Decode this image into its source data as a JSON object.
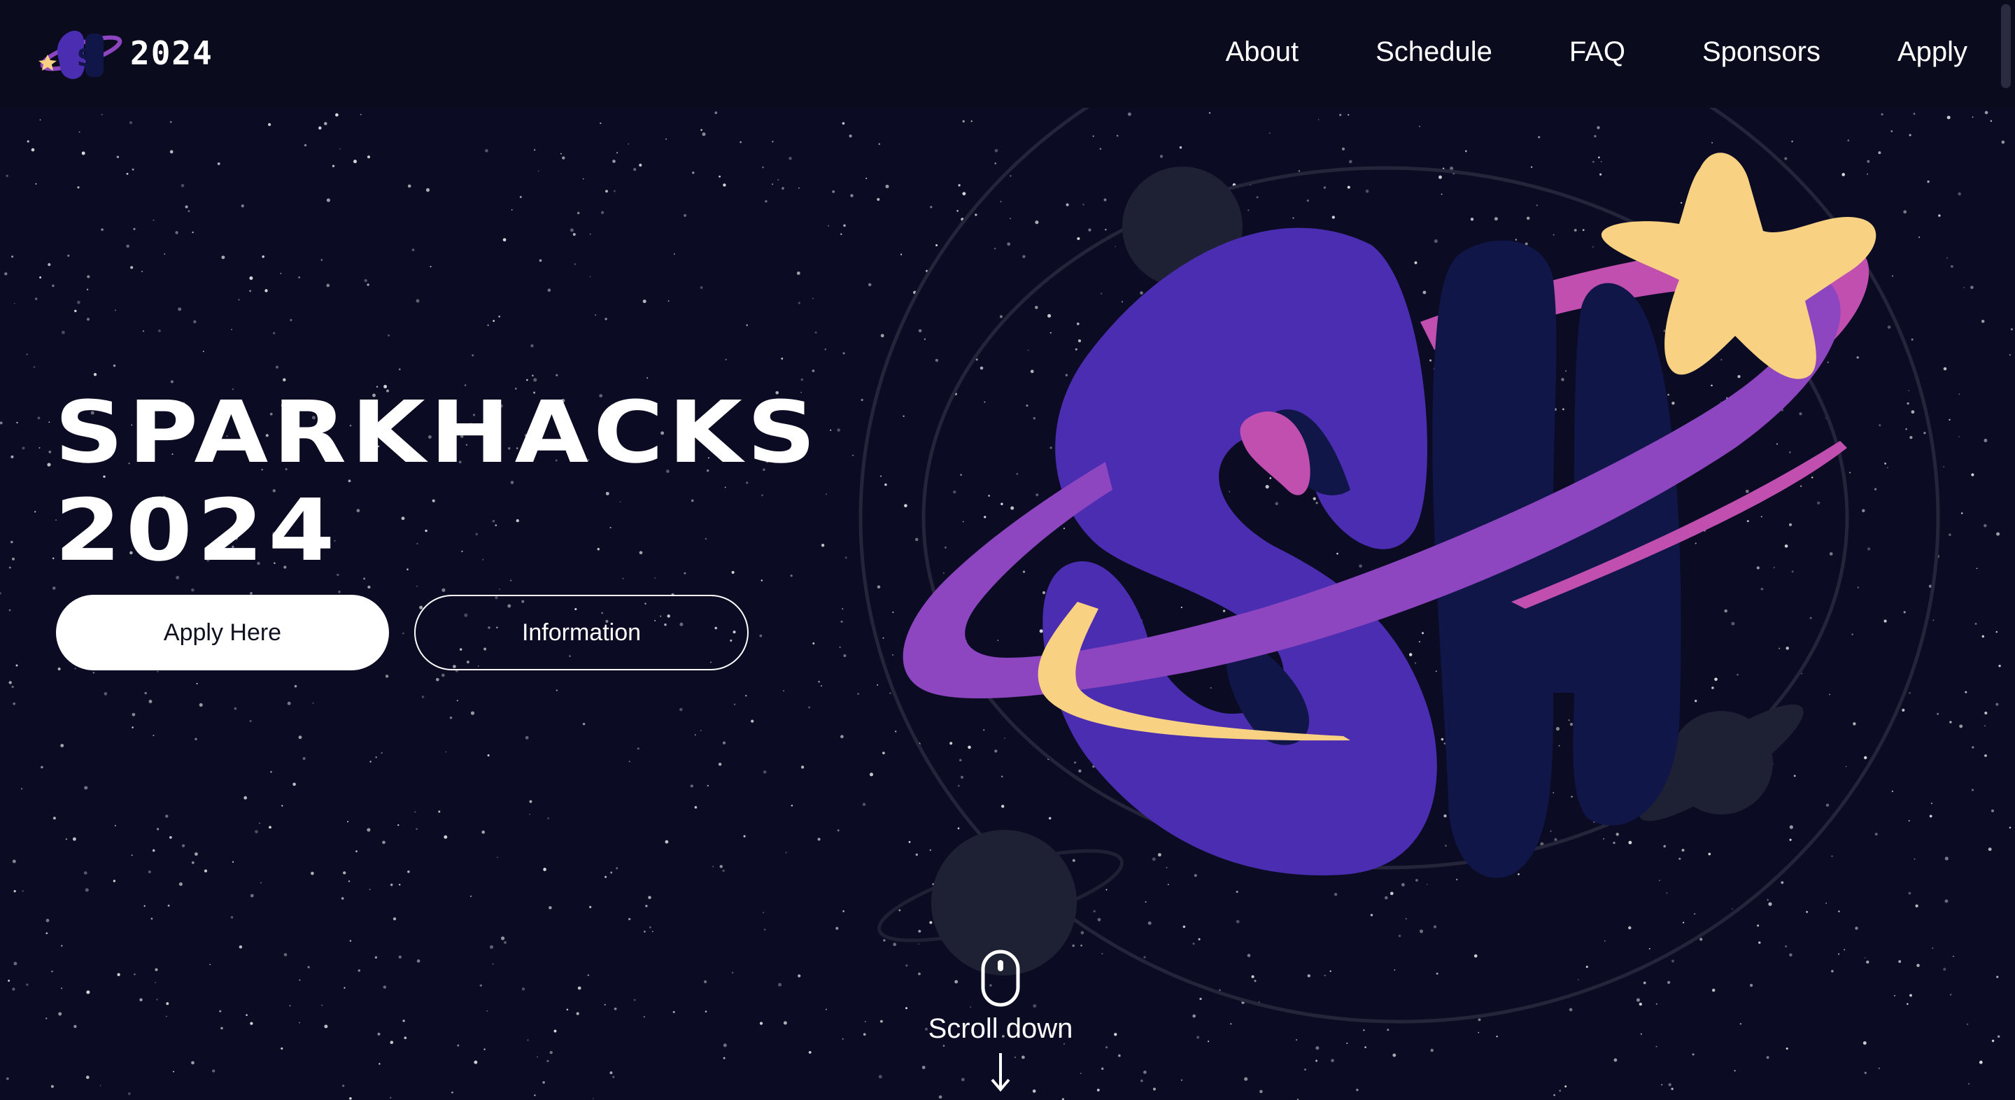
{
  "header": {
    "brand_year": "2024",
    "logo_icon": "sparkhacks-planet-logo-icon",
    "nav": [
      {
        "label": "About"
      },
      {
        "label": "Schedule"
      },
      {
        "label": "FAQ"
      },
      {
        "label": "Sponsors"
      },
      {
        "label": "Apply"
      }
    ]
  },
  "hero": {
    "title_line1": "SPARKHACKS",
    "title_line2": "2024",
    "apply_button": "Apply Here",
    "info_button": "Information",
    "scroll_label": "Scroll down",
    "mouse_icon": "mouse-icon",
    "arrow_icon": "arrow-down-icon"
  },
  "illustration": {
    "name": "sh-planet-logo",
    "letters": "SH"
  },
  "colors": {
    "background": "#0b0c24",
    "header": "#0a0b1d",
    "purple": "#4a2db0",
    "navy": "#111648",
    "magenta": "#c04fb0",
    "violet": "#8d45c0",
    "gold": "#f8d183",
    "planet_gray": "#1e2033"
  }
}
